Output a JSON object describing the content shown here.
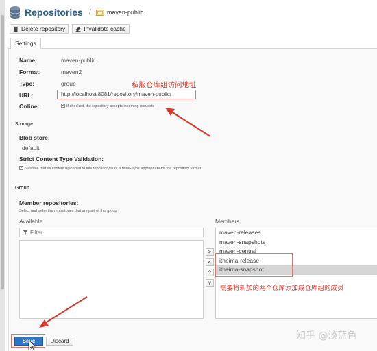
{
  "header": {
    "title": "Repositories",
    "separator": "/",
    "breadcrumb": "maven-public"
  },
  "toolbar": {
    "delete_label": "Delete repository",
    "invalidate_label": "Invalidate cache"
  },
  "tabs": [
    {
      "label": "Settings"
    }
  ],
  "settings": {
    "name_label": "Name:",
    "name_value": "maven-public",
    "format_label": "Format:",
    "format_value": "maven2",
    "type_label": "Type:",
    "type_value": "group",
    "url_label": "URL:",
    "url_value": "http://localhost:8081/repository/maven-public/",
    "online_label": "Online:",
    "online_checked": true,
    "online_text": "If checked, the repository accepts incoming requests"
  },
  "storage": {
    "section": "Storage",
    "blob_label": "Blob store:",
    "blob_value": "default",
    "validation_label": "Strict Content Type Validation:",
    "validation_checked": true,
    "validation_text": "Validate that all content uploaded to this repository is of a MIME type appropriate for the repository format"
  },
  "group": {
    "section": "Group",
    "members_label": "Member repositories:",
    "members_hint": "Select and order the repositories that are part of this group",
    "available_label": "Available",
    "filter_placeholder": "Filter",
    "members_column_label": "Members",
    "transfer_buttons": [
      ">",
      "<",
      "^",
      "v"
    ],
    "members": [
      {
        "name": "maven-releases",
        "selected": false
      },
      {
        "name": "maven-snapshots",
        "selected": false
      },
      {
        "name": "maven-central",
        "selected": false
      },
      {
        "name": "itheima-release",
        "selected": false
      },
      {
        "name": "itheima-snapshot",
        "selected": true
      }
    ]
  },
  "actions": {
    "save_label": "Save",
    "discard_label": "Discard"
  },
  "annotations": {
    "url_note": "私服仓库组访问地址",
    "members_note": "需要将新加的两个仓库添加成仓库组的成员",
    "color": "#d43a2e"
  },
  "watermark": "知乎 @淡蓝色"
}
